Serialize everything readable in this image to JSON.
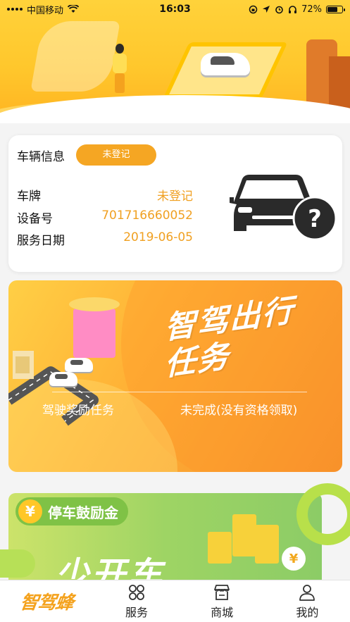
{
  "status_bar": {
    "carrier": "中国移动",
    "time": "16:03",
    "battery": "72%",
    "battery_level": 0.72
  },
  "vehicle_card": {
    "title": "车辆信息",
    "badge": "未登记",
    "rows": [
      {
        "label": "车牌",
        "value": "未登记"
      },
      {
        "label": "设备号",
        "value": "701716660052"
      },
      {
        "label": "服务日期",
        "value": "2019-06-05"
      }
    ],
    "icon": "car-question-icon"
  },
  "task_card": {
    "title_line1": "智驾出行",
    "title_line2": "任务",
    "left_label": "驾驶奖励任务",
    "right_label": "未完成(没有资格领取)"
  },
  "parking_card": {
    "pill_icon": "yen-icon",
    "pill_symbol": "¥",
    "pill_label": "停车鼓励金",
    "big_text": "少开车",
    "coin_symbol": "¥"
  },
  "tab_bar": {
    "brand": "智驾蜂",
    "tabs": [
      {
        "label": "服务",
        "icon": "grid-icon"
      },
      {
        "label": "商城",
        "icon": "store-icon"
      },
      {
        "label": "我的",
        "icon": "user-icon"
      }
    ]
  },
  "colors": {
    "accent": "#f5a623",
    "value_text": "#f0a021",
    "hero_yellow": "#ffc72c",
    "task_orange": "#f5902c",
    "parking_green": "#9ed464"
  }
}
